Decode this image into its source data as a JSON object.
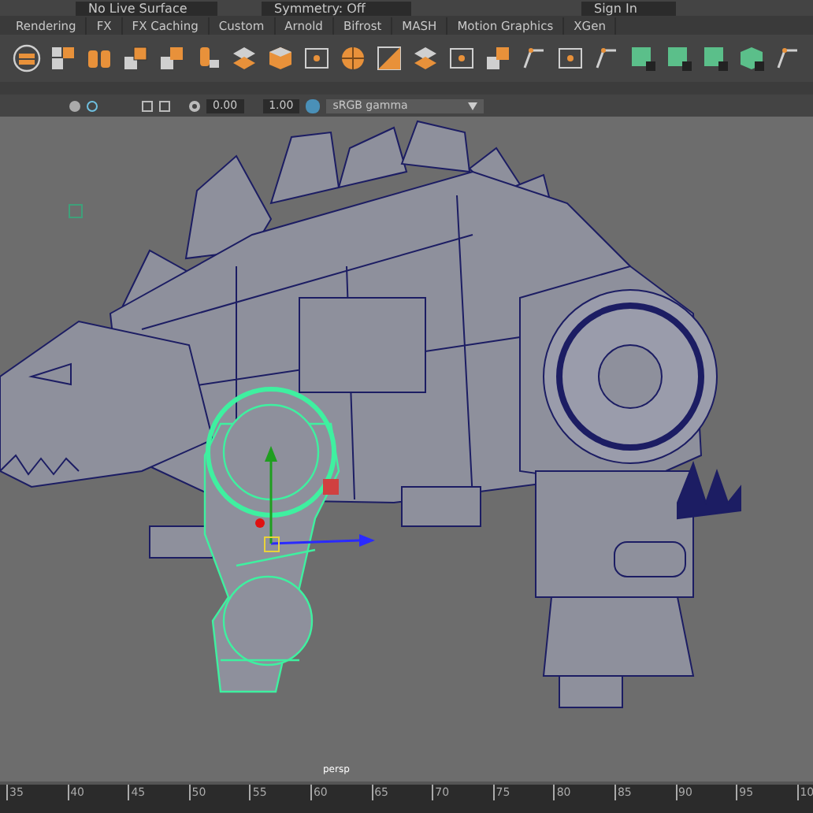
{
  "status_line": {
    "live_surface": "No Live Surface",
    "symmetry": "Symmetry: Off",
    "sign_in": "Sign In"
  },
  "shelf_tabs": [
    {
      "label": "Rendering",
      "selected": false
    },
    {
      "label": "FX",
      "selected": false
    },
    {
      "label": "FX Caching",
      "selected": false
    },
    {
      "label": "Custom",
      "selected": false
    },
    {
      "label": "Arnold",
      "selected": false
    },
    {
      "label": "Bifrost",
      "selected": false
    },
    {
      "label": "MASH",
      "selected": false
    },
    {
      "label": "Motion Graphics",
      "selected": false
    },
    {
      "label": "XGen",
      "selected": false
    }
  ],
  "viewport_toolbar": {
    "exposure": "0.00",
    "gamma": "1.00",
    "color_space": "sRGB gamma"
  },
  "viewport": {
    "camera": "persp"
  },
  "timeline": {
    "ticks": [
      "35",
      "40",
      "45",
      "50",
      "55",
      "60",
      "65",
      "70",
      "75",
      "80",
      "85",
      "90",
      "95",
      "10"
    ]
  }
}
